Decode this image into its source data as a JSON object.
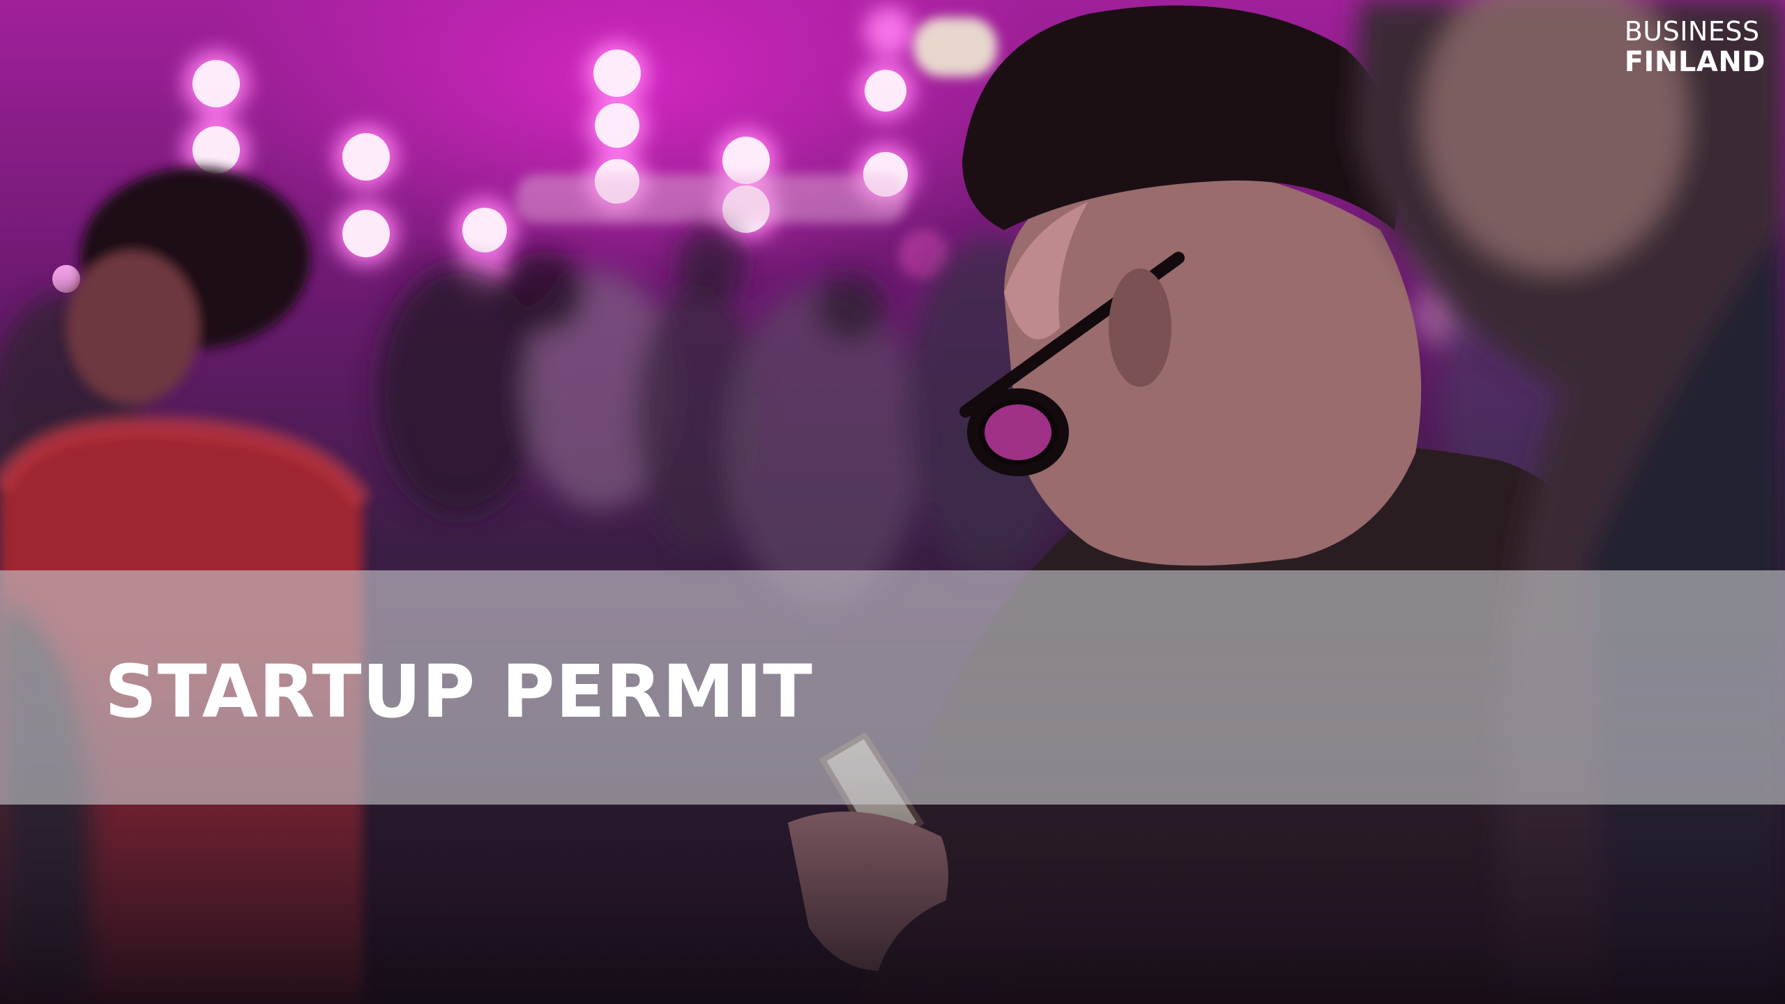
{
  "slide": {
    "title": "STARTUP PERMIT",
    "background_image": "blurred-event-crowd-magenta-lights-man-with-phone"
  },
  "logo": {
    "line1": "BUSINESS",
    "line2": "FINLAND"
  },
  "colors": {
    "accent_magenta": "#b0209f",
    "title_text": "#ffffff",
    "band_overlay": "#c8c8cd"
  }
}
